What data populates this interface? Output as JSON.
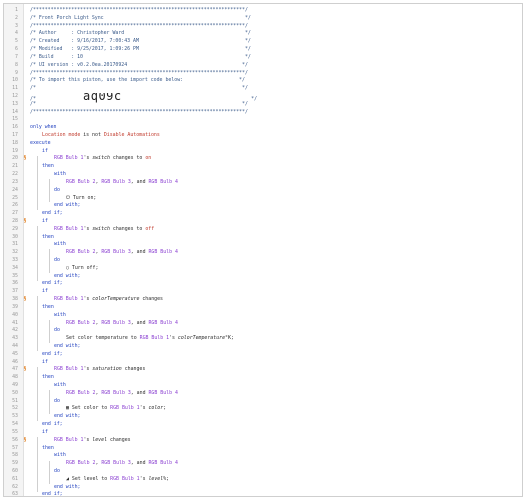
{
  "gutter_mark": "§",
  "lines": [
    {
      "n": "1",
      "m": false,
      "ind": 0,
      "sp": [
        {
          "t": "/************************************************************************/",
          "c": "comment"
        }
      ]
    },
    {
      "n": "2",
      "m": false,
      "ind": 0,
      "sp": [
        {
          "t": "/* Front Porch Light Sync                                                */",
          "c": "comment"
        }
      ]
    },
    {
      "n": "3",
      "m": false,
      "ind": 0,
      "sp": [
        {
          "t": "/************************************************************************/",
          "c": "comment"
        }
      ]
    },
    {
      "n": "4",
      "m": false,
      "ind": 0,
      "sp": [
        {
          "t": "/* Author     : Christopher Ward                                         */",
          "c": "comment"
        }
      ]
    },
    {
      "n": "5",
      "m": false,
      "ind": 0,
      "sp": [
        {
          "t": "/* Created    : 9/16/2017, 7:00:43 AM                                    */",
          "c": "comment"
        }
      ]
    },
    {
      "n": "6",
      "m": false,
      "ind": 0,
      "sp": [
        {
          "t": "/* Modified   : 9/25/2017, 1:09:26 PM                                    */",
          "c": "comment"
        }
      ]
    },
    {
      "n": "7",
      "m": false,
      "ind": 0,
      "sp": [
        {
          "t": "/* Build      : 10                                                       */",
          "c": "comment"
        }
      ]
    },
    {
      "n": "8",
      "m": false,
      "ind": 0,
      "sp": [
        {
          "t": "/* UI version : v0.2.0ea.20170924                                       */",
          "c": "comment"
        }
      ]
    },
    {
      "n": "9",
      "m": false,
      "ind": 0,
      "sp": [
        {
          "t": "/************************************************************************/",
          "c": "comment"
        }
      ]
    },
    {
      "n": "10",
      "m": false,
      "ind": 0,
      "sp": [
        {
          "t": "/* To import this piston, use the import code below:                   */",
          "c": "comment"
        }
      ]
    },
    {
      "n": "11",
      "m": false,
      "ind": 0,
      "sp": [
        {
          "t": "/*                                                                      */",
          "c": "comment"
        }
      ]
    },
    {
      "n": "12",
      "m": false,
      "ind": 0,
      "sp": [
        {
          "t": "/*                ",
          "c": "comment"
        },
        {
          "t": "aq09c",
          "c": "pistonid"
        },
        {
          "t": "                                            */",
          "c": "comment"
        }
      ]
    },
    {
      "n": "13",
      "m": false,
      "ind": 0,
      "sp": [
        {
          "t": "/*                                                                      */",
          "c": "comment"
        }
      ]
    },
    {
      "n": "14",
      "m": false,
      "ind": 0,
      "sp": [
        {
          "t": "/************************************************************************/",
          "c": "comment"
        }
      ]
    },
    {
      "n": "15",
      "m": false,
      "ind": 0,
      "sp": []
    },
    {
      "n": "16",
      "m": false,
      "ind": 0,
      "sp": [
        {
          "t": "only when",
          "c": "kw"
        }
      ]
    },
    {
      "n": "17",
      "m": false,
      "ind": 1,
      "sp": [
        {
          "t": "Location mode",
          "c": "red"
        },
        {
          "t": " is not ",
          "c": ""
        },
        {
          "t": "Disable Automations",
          "c": "red"
        }
      ]
    },
    {
      "n": "18",
      "m": false,
      "ind": 0,
      "sp": [
        {
          "t": "execute",
          "c": "kw"
        }
      ]
    },
    {
      "n": "19",
      "m": false,
      "ind": 1,
      "sp": [
        {
          "t": "if",
          "c": "kw"
        }
      ]
    },
    {
      "n": "20",
      "m": true,
      "ind": 2,
      "sp": [
        {
          "t": "RGB Bulb 1",
          "c": "dev"
        },
        {
          "t": "'s ",
          "c": ""
        },
        {
          "t": "switch",
          "c": "it"
        },
        {
          "t": " changes to ",
          "c": ""
        },
        {
          "t": "on",
          "c": "red"
        }
      ]
    },
    {
      "n": "21",
      "m": false,
      "ind": 1,
      "sp": [
        {
          "t": "then",
          "c": "kw"
        }
      ]
    },
    {
      "n": "22",
      "m": false,
      "ind": 2,
      "sp": [
        {
          "t": "with",
          "c": "kw"
        }
      ]
    },
    {
      "n": "23",
      "m": false,
      "ind": 3,
      "sp": [
        {
          "t": "RGB Bulb 2",
          "c": "dev"
        },
        {
          "t": ", ",
          "c": ""
        },
        {
          "t": "RGB Bulb 3",
          "c": "dev"
        },
        {
          "t": ", and ",
          "c": ""
        },
        {
          "t": "RGB Bulb 4",
          "c": "dev"
        }
      ]
    },
    {
      "n": "24",
      "m": false,
      "ind": 2,
      "sp": [
        {
          "t": "do",
          "c": "kw"
        }
      ]
    },
    {
      "n": "25",
      "m": false,
      "ind": 3,
      "sp": [
        {
          "t": "⏻ Turn on;",
          "c": ""
        }
      ]
    },
    {
      "n": "26",
      "m": false,
      "ind": 2,
      "sp": [
        {
          "t": "end with;",
          "c": "kw"
        }
      ]
    },
    {
      "n": "27",
      "m": false,
      "ind": 1,
      "sp": [
        {
          "t": "end if;",
          "c": "kw"
        }
      ]
    },
    {
      "n": "28",
      "m": true,
      "ind": 1,
      "sp": [
        {
          "t": "if",
          "c": "kw"
        }
      ]
    },
    {
      "n": "29",
      "m": false,
      "ind": 2,
      "sp": [
        {
          "t": "RGB Bulb 1",
          "c": "dev"
        },
        {
          "t": "'s ",
          "c": ""
        },
        {
          "t": "switch",
          "c": "it"
        },
        {
          "t": " changes to ",
          "c": ""
        },
        {
          "t": "off",
          "c": "red"
        }
      ]
    },
    {
      "n": "30",
      "m": false,
      "ind": 1,
      "sp": [
        {
          "t": "then",
          "c": "kw"
        }
      ]
    },
    {
      "n": "31",
      "m": false,
      "ind": 2,
      "sp": [
        {
          "t": "with",
          "c": "kw"
        }
      ]
    },
    {
      "n": "32",
      "m": false,
      "ind": 3,
      "sp": [
        {
          "t": "RGB Bulb 2",
          "c": "dev"
        },
        {
          "t": ", ",
          "c": ""
        },
        {
          "t": "RGB Bulb 3",
          "c": "dev"
        },
        {
          "t": ", and ",
          "c": ""
        },
        {
          "t": "RGB Bulb 4",
          "c": "dev"
        }
      ]
    },
    {
      "n": "33",
      "m": false,
      "ind": 2,
      "sp": [
        {
          "t": "do",
          "c": "kw"
        }
      ]
    },
    {
      "n": "34",
      "m": false,
      "ind": 3,
      "sp": [
        {
          "t": "◯ Turn off;",
          "c": ""
        }
      ]
    },
    {
      "n": "35",
      "m": false,
      "ind": 2,
      "sp": [
        {
          "t": "end with;",
          "c": "kw"
        }
      ]
    },
    {
      "n": "36",
      "m": false,
      "ind": 1,
      "sp": [
        {
          "t": "end if;",
          "c": "kw"
        }
      ]
    },
    {
      "n": "37",
      "m": false,
      "ind": 1,
      "sp": [
        {
          "t": "if",
          "c": "kw"
        }
      ]
    },
    {
      "n": "38",
      "m": true,
      "ind": 2,
      "sp": [
        {
          "t": "RGB Bulb 1",
          "c": "dev"
        },
        {
          "t": "'s ",
          "c": ""
        },
        {
          "t": "colorTemperature",
          "c": "it"
        },
        {
          "t": " changes",
          "c": ""
        }
      ]
    },
    {
      "n": "39",
      "m": false,
      "ind": 1,
      "sp": [
        {
          "t": "then",
          "c": "kw"
        }
      ]
    },
    {
      "n": "40",
      "m": false,
      "ind": 2,
      "sp": [
        {
          "t": "with",
          "c": "kw"
        }
      ]
    },
    {
      "n": "41",
      "m": false,
      "ind": 3,
      "sp": [
        {
          "t": "RGB Bulb 2",
          "c": "dev"
        },
        {
          "t": ", ",
          "c": ""
        },
        {
          "t": "RGB Bulb 3",
          "c": "dev"
        },
        {
          "t": ", and ",
          "c": ""
        },
        {
          "t": "RGB Bulb 4",
          "c": "dev"
        }
      ]
    },
    {
      "n": "42",
      "m": false,
      "ind": 2,
      "sp": [
        {
          "t": "do",
          "c": "kw"
        }
      ]
    },
    {
      "n": "43",
      "m": false,
      "ind": 3,
      "sp": [
        {
          "t": "Set color temperature to ",
          "c": ""
        },
        {
          "t": "RGB Bulb 1",
          "c": "dev"
        },
        {
          "t": "'s ",
          "c": ""
        },
        {
          "t": "colorTemperature",
          "c": "it"
        },
        {
          "t": "°K;",
          "c": ""
        }
      ]
    },
    {
      "n": "44",
      "m": false,
      "ind": 2,
      "sp": [
        {
          "t": "end with;",
          "c": "kw"
        }
      ]
    },
    {
      "n": "45",
      "m": false,
      "ind": 1,
      "sp": [
        {
          "t": "end if;",
          "c": "kw"
        }
      ]
    },
    {
      "n": "46",
      "m": false,
      "ind": 1,
      "sp": [
        {
          "t": "if",
          "c": "kw"
        }
      ]
    },
    {
      "n": "47",
      "m": true,
      "ind": 2,
      "sp": [
        {
          "t": "RGB Bulb 1",
          "c": "dev"
        },
        {
          "t": "'s ",
          "c": ""
        },
        {
          "t": "saturation",
          "c": "it"
        },
        {
          "t": " changes",
          "c": ""
        }
      ]
    },
    {
      "n": "48",
      "m": false,
      "ind": 1,
      "sp": [
        {
          "t": "then",
          "c": "kw"
        }
      ]
    },
    {
      "n": "49",
      "m": false,
      "ind": 2,
      "sp": [
        {
          "t": "with",
          "c": "kw"
        }
      ]
    },
    {
      "n": "50",
      "m": false,
      "ind": 3,
      "sp": [
        {
          "t": "RGB Bulb 2",
          "c": "dev"
        },
        {
          "t": ", ",
          "c": ""
        },
        {
          "t": "RGB Bulb 3",
          "c": "dev"
        },
        {
          "t": ", and ",
          "c": ""
        },
        {
          "t": "RGB Bulb 4",
          "c": "dev"
        }
      ]
    },
    {
      "n": "51",
      "m": false,
      "ind": 2,
      "sp": [
        {
          "t": "do",
          "c": "kw"
        }
      ]
    },
    {
      "n": "52",
      "m": false,
      "ind": 3,
      "sp": [
        {
          "t": "▦ Set color to ",
          "c": ""
        },
        {
          "t": "RGB Bulb 1",
          "c": "dev"
        },
        {
          "t": "'s ",
          "c": ""
        },
        {
          "t": "color",
          "c": "it"
        },
        {
          "t": ";",
          "c": ""
        }
      ]
    },
    {
      "n": "53",
      "m": false,
      "ind": 2,
      "sp": [
        {
          "t": "end with;",
          "c": "kw"
        }
      ]
    },
    {
      "n": "54",
      "m": false,
      "ind": 1,
      "sp": [
        {
          "t": "end if;",
          "c": "kw"
        }
      ]
    },
    {
      "n": "55",
      "m": false,
      "ind": 1,
      "sp": [
        {
          "t": "if",
          "c": "kw"
        }
      ]
    },
    {
      "n": "56",
      "m": true,
      "ind": 2,
      "sp": [
        {
          "t": "RGB Bulb 1",
          "c": "dev"
        },
        {
          "t": "'s ",
          "c": ""
        },
        {
          "t": "level",
          "c": "it"
        },
        {
          "t": " changes",
          "c": ""
        }
      ]
    },
    {
      "n": "57",
      "m": false,
      "ind": 1,
      "sp": [
        {
          "t": "then",
          "c": "kw"
        }
      ]
    },
    {
      "n": "58",
      "m": false,
      "ind": 2,
      "sp": [
        {
          "t": "with",
          "c": "kw"
        }
      ]
    },
    {
      "n": "59",
      "m": false,
      "ind": 3,
      "sp": [
        {
          "t": "RGB Bulb 2",
          "c": "dev"
        },
        {
          "t": ", ",
          "c": ""
        },
        {
          "t": "RGB Bulb 3",
          "c": "dev"
        },
        {
          "t": ", and ",
          "c": ""
        },
        {
          "t": "RGB Bulb 4",
          "c": "dev"
        }
      ]
    },
    {
      "n": "60",
      "m": false,
      "ind": 2,
      "sp": [
        {
          "t": "do",
          "c": "kw"
        }
      ]
    },
    {
      "n": "61",
      "m": false,
      "ind": 3,
      "sp": [
        {
          "t": "◢ Set level to ",
          "c": ""
        },
        {
          "t": "RGB Bulb 1",
          "c": "dev"
        },
        {
          "t": "'s ",
          "c": ""
        },
        {
          "t": "level",
          "c": "it"
        },
        {
          "t": "%;",
          "c": ""
        }
      ]
    },
    {
      "n": "62",
      "m": false,
      "ind": 2,
      "sp": [
        {
          "t": "end with;",
          "c": "kw"
        }
      ]
    },
    {
      "n": "63",
      "m": false,
      "ind": 1,
      "sp": [
        {
          "t": "end if;",
          "c": "kw"
        }
      ]
    },
    {
      "n": "64",
      "m": false,
      "ind": 0,
      "sp": [
        {
          "t": "end execute;",
          "c": "kw"
        }
      ]
    }
  ],
  "blocks": [
    {
      "s": "19",
      "e": "27",
      "ind": 1
    },
    {
      "s": "22",
      "e": "26",
      "ind": 2
    },
    {
      "s": "28",
      "e": "36",
      "ind": 1
    },
    {
      "s": "31",
      "e": "35",
      "ind": 2
    },
    {
      "s": "37",
      "e": "45",
      "ind": 1
    },
    {
      "s": "40",
      "e": "44",
      "ind": 2
    },
    {
      "s": "46",
      "e": "54",
      "ind": 1
    },
    {
      "s": "49",
      "e": "53",
      "ind": 2
    },
    {
      "s": "55",
      "e": "63",
      "ind": 1
    },
    {
      "s": "58",
      "e": "62",
      "ind": 2
    }
  ]
}
